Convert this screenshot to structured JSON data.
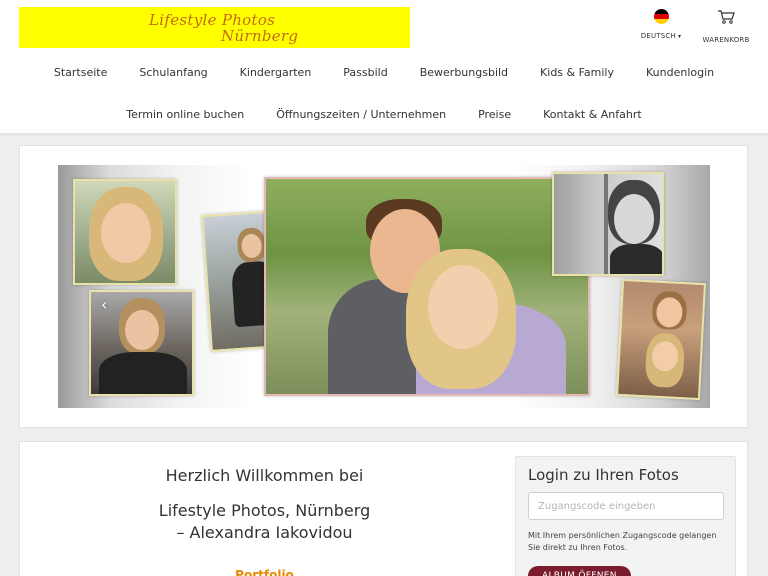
{
  "logo": {
    "line1": "Lifestyle Photos",
    "line2": "Nürnberg"
  },
  "language": {
    "label": "DEUTSCH",
    "caret": "▾",
    "flag_colors": [
      "#000000",
      "#dd0000",
      "#ffce00"
    ]
  },
  "cart": {
    "label": "WARENKORB",
    "icon": "cart-icon"
  },
  "nav": {
    "row1": [
      "Startseite",
      "Schulanfang",
      "Kindergarten",
      "Passbild",
      "Bewerbungsbild",
      "Kids & Family",
      "Kundenlogin"
    ],
    "row2": [
      "Termin online buchen",
      "Öffnungszeiten / Unternehmen",
      "Preise",
      "Kontakt & Anfahrt"
    ]
  },
  "banner": {
    "prev_arrow": "‹"
  },
  "welcome": {
    "line1": "Herzlich Willkommen bei",
    "line2": "Lifestyle Photos, Nürnberg",
    "line3": "– Alexandra Iakovidou",
    "portfolio": "Portfolio"
  },
  "login": {
    "title": "Login zu Ihren Fotos",
    "placeholder": "Zugangscode eingeben",
    "description": "Mit Ihrem persönlichen Zugangscode gelangen Sie direkt zu Ihren Fotos.",
    "button": "ALBUM ÖFFNEN"
  },
  "colors": {
    "logo_bg": "#ffff00",
    "logo_text": "#c46a10",
    "button_bg": "#7a1c2e",
    "portfolio": "#e68a00"
  }
}
